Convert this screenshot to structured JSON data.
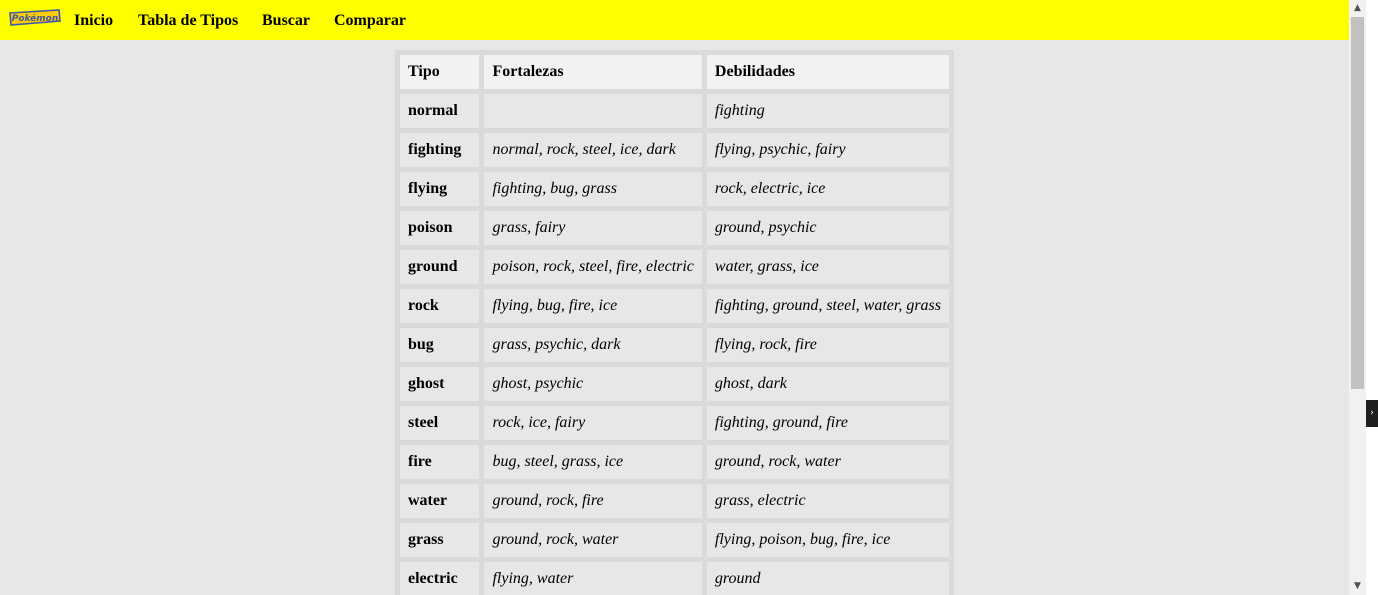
{
  "nav": {
    "logo_text": "Pokémon",
    "links": [
      "Inicio",
      "Tabla de Tipos",
      "Buscar",
      "Comparar"
    ]
  },
  "table": {
    "headers": [
      "Tipo",
      "Fortalezas",
      "Debilidades"
    ],
    "rows": [
      {
        "tipo": "normal",
        "fortalezas": "",
        "debilidades": "fighting"
      },
      {
        "tipo": "fighting",
        "fortalezas": "normal, rock, steel, ice, dark",
        "debilidades": "flying, psychic, fairy"
      },
      {
        "tipo": "flying",
        "fortalezas": "fighting, bug, grass",
        "debilidades": "rock, electric, ice"
      },
      {
        "tipo": "poison",
        "fortalezas": "grass, fairy",
        "debilidades": "ground, psychic"
      },
      {
        "tipo": "ground",
        "fortalezas": "poison, rock, steel, fire, electric",
        "debilidades": "water, grass, ice"
      },
      {
        "tipo": "rock",
        "fortalezas": "flying, bug, fire, ice",
        "debilidades": "fighting, ground, steel, water, grass"
      },
      {
        "tipo": "bug",
        "fortalezas": "grass, psychic, dark",
        "debilidades": "flying, rock, fire"
      },
      {
        "tipo": "ghost",
        "fortalezas": "ghost, psychic",
        "debilidades": "ghost, dark"
      },
      {
        "tipo": "steel",
        "fortalezas": "rock, ice, fairy",
        "debilidades": "fighting, ground, fire"
      },
      {
        "tipo": "fire",
        "fortalezas": "bug, steel, grass, ice",
        "debilidades": "ground, rock, water"
      },
      {
        "tipo": "water",
        "fortalezas": "ground, rock, fire",
        "debilidades": "grass, electric"
      },
      {
        "tipo": "grass",
        "fortalezas": "ground, rock, water",
        "debilidades": "flying, poison, bug, fire, ice"
      },
      {
        "tipo": "electric",
        "fortalezas": "flying, water",
        "debilidades": "ground"
      }
    ]
  },
  "colors": {
    "navbar": "#ffff00",
    "background": "#e7e7e7",
    "header_cell": "#f2f2f2"
  }
}
